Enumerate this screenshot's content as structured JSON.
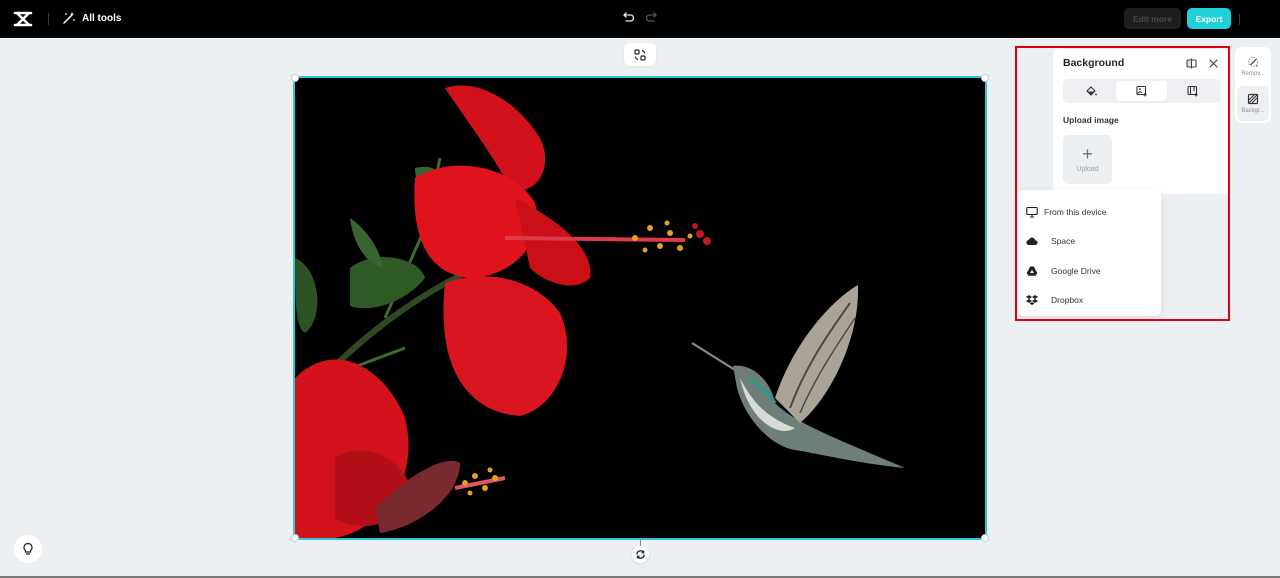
{
  "topbar": {
    "logo_icon": "capcut-logo-icon",
    "all_tools_label": "All tools",
    "all_tools_icon": "magic-wand-icon",
    "undo_icon": "undo-icon",
    "redo_icon": "redo-icon",
    "edit_more_label": "Edit more",
    "export_label": "Export"
  },
  "canvas": {
    "swap_icon": "swap-layout-icon",
    "rotate_icon": "rotate-icon",
    "image_description": "Red hibiscus flowers with green leaves and a hummingbird on black background",
    "selection_color": "#2fc6d6"
  },
  "tips": {
    "icon": "lightbulb-icon"
  },
  "background_panel": {
    "title": "Background",
    "compare_icon": "compare-icon",
    "close_icon": "close-icon",
    "tabs": [
      {
        "name": "color",
        "icon": "paint-bucket-icon",
        "active": false
      },
      {
        "name": "image",
        "icon": "image-add-icon",
        "active": true
      },
      {
        "name": "template",
        "icon": "ai-background-icon",
        "active": false
      }
    ],
    "upload_section_label": "Upload image",
    "upload_tile_label": "Upload",
    "upload_tile_icon": "plus-icon"
  },
  "upload_menu": {
    "items": [
      {
        "label": "From this device",
        "icon": "monitor-icon"
      },
      {
        "label": "Space",
        "icon": "cloud-icon"
      },
      {
        "label": "Google Drive",
        "icon": "google-drive-icon"
      },
      {
        "label": "Dropbox",
        "icon": "dropbox-icon"
      }
    ]
  },
  "side_toolbar": {
    "items": [
      {
        "label": "Remov...",
        "icon": "remove-background-icon",
        "active": false
      },
      {
        "label": "Backgr...",
        "icon": "background-icon",
        "active": true
      }
    ]
  },
  "colors": {
    "accent": "#20d1d8",
    "highlight": "#e3000b",
    "topbar": "#000000",
    "workspace": "#edf0f3"
  }
}
